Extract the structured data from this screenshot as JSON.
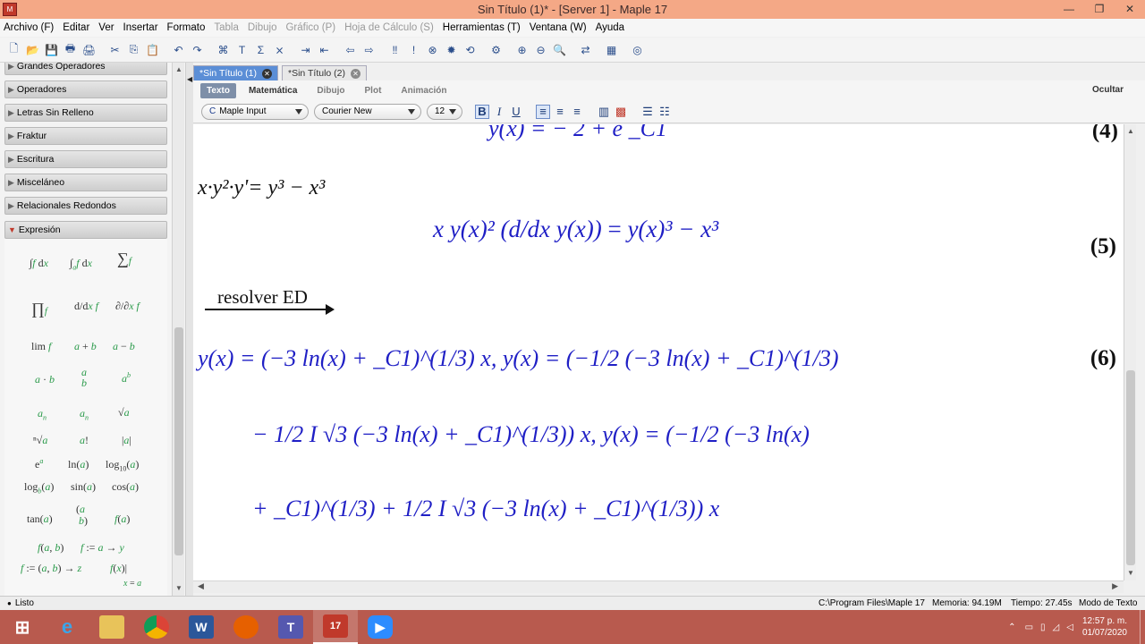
{
  "window": {
    "title": "Sin Título (1)* - [Server 1] - Maple 17",
    "app_icon_label": "M"
  },
  "menu": [
    "Archivo (F)",
    "Editar",
    "Ver",
    "Insertar",
    "Formato",
    "Tabla",
    "Dibujo",
    "Gráfico (P)",
    "Hoja de Cálculo (S)",
    "Herramientas (T)",
    "Ventana (W)",
    "Ayuda"
  ],
  "menu_disabled": [
    "Tabla",
    "Dibujo",
    "Gráfico (P)",
    "Hoja de Cálculo (S)"
  ],
  "palettes": {
    "headers": [
      "Grandes Operadores",
      "Operadores",
      "Letras Sin Relleno",
      "Fraktur",
      "Escritura",
      "Misceláneo",
      "Relacionales Redondos",
      "Expresión"
    ],
    "open": "Expresión",
    "expression_items": [
      "∫f dx",
      "∫ab f dx",
      "∑i=kn f",
      "∏i=kn f",
      "d/dx f",
      "∂/∂x f",
      "lim x→a f",
      "a + b",
      "a − b",
      "a · b",
      "a/b",
      "a^b",
      "a_n",
      "a_n",
      "√a",
      "n√a",
      "a!",
      "|a|",
      "e^a",
      "ln(a)",
      "log10(a)",
      "logb(a)",
      "sin(a)",
      "cos(a)",
      "tan(a)",
      "(a b)",
      "f(a)",
      "f(a, b)",
      "f := a → y",
      "f := (a, b) → z",
      "f(x)|x = a"
    ]
  },
  "tabs": [
    {
      "label": "*Sin Título (1)",
      "active": true
    },
    {
      "label": "*Sin Título (2)",
      "active": false
    }
  ],
  "context_bar": {
    "modes": [
      "Texto",
      "Matemática",
      "Dibujo",
      "Plot",
      "Animación"
    ],
    "selected": "Texto",
    "hide": "Ocultar"
  },
  "format_bar": {
    "input_mode": "Maple Input",
    "font": "Courier New",
    "size": "12",
    "bold": "B",
    "italic": "I",
    "underline": "U"
  },
  "document": {
    "eq4": {
      "label": "(4)",
      "text_partial": "y(x) = − 2 + e  _C1"
    },
    "input5": "x·y²·y'= y³ − x³",
    "eq5": {
      "label": "(5)",
      "lhs": "x y(x)² (d/dx y(x))",
      "rhs": "y(x)³ − x³"
    },
    "arrow_label": "resolver ED",
    "eq6": {
      "label": "(6)",
      "line1": "y(x) = (−3 ln(x) + _C1)^(1/3) x, y(x) = (−1/2 (−3 ln(x) + _C1)^(1/3)",
      "line2": "− 1/2 I √3 (−3 ln(x) + _C1)^(1/3)) x, y(x) = (−1/2 (−3 ln(x)",
      "line3": "+ _C1)^(1/3) + 1/2 I √3 (−3 ln(x) + _C1)^(1/3)) x"
    }
  },
  "status": {
    "left": "Listo",
    "path": "C:\\Program Files\\Maple 17",
    "memory": "Memoria: 94.19M",
    "time": "Tiempo: 27.45s",
    "mode": "Modo de Texto"
  },
  "taskbar": {
    "apps": [
      "windows-start",
      "internet-explorer",
      "file-explorer",
      "chrome",
      "word",
      "firefox",
      "teams",
      "maple",
      "zoom"
    ],
    "clock_time": "12:57 p. m.",
    "clock_date": "01/07/2020"
  }
}
